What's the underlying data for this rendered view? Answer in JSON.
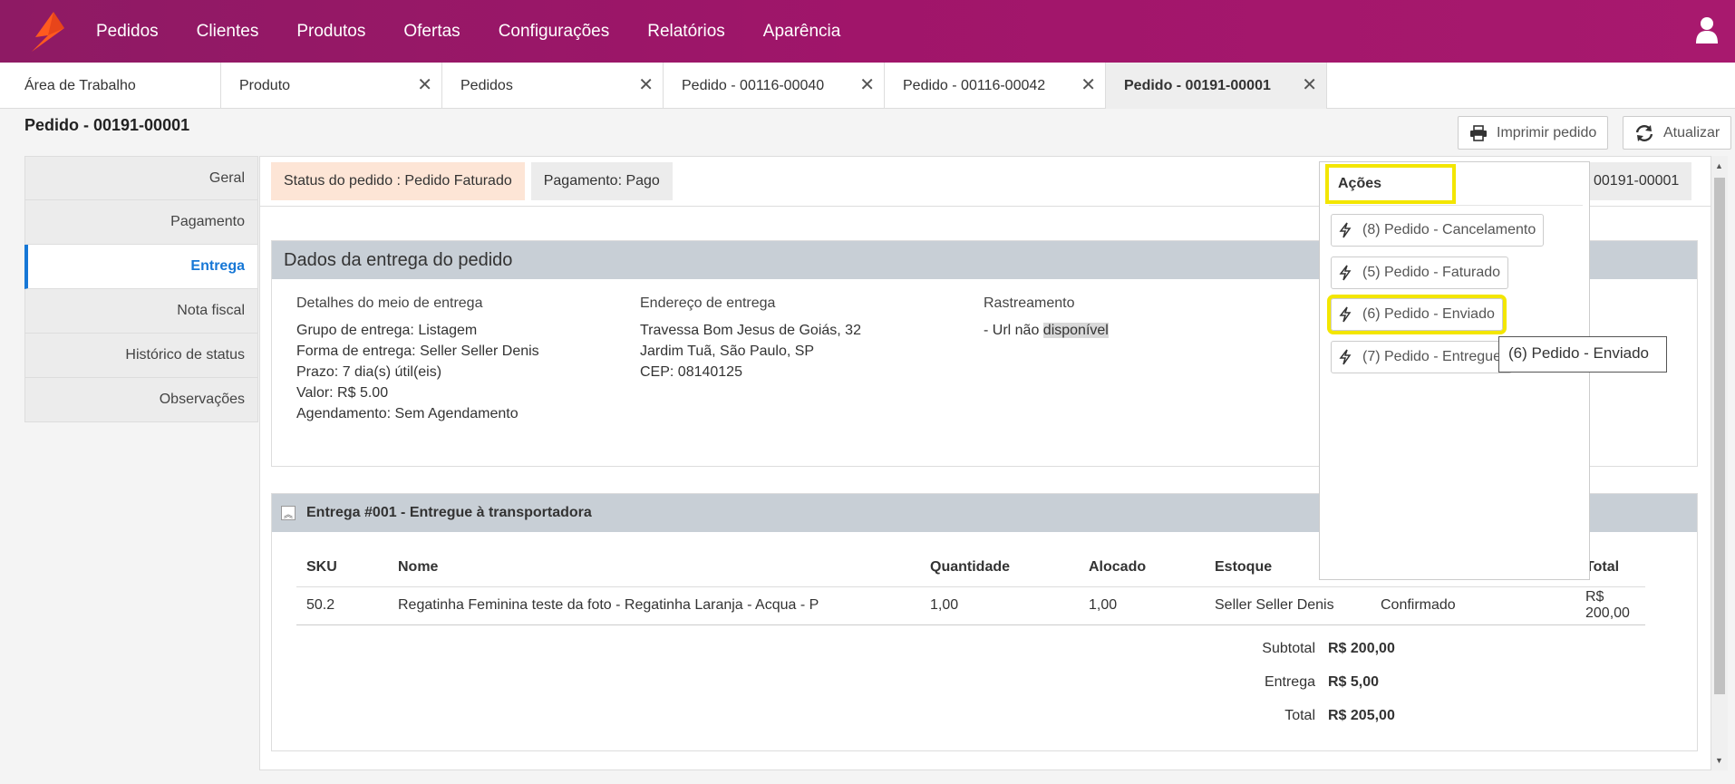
{
  "navbar": {
    "items": [
      "Pedidos",
      "Clientes",
      "Produtos",
      "Ofertas",
      "Configurações",
      "Relatórios",
      "Aparência"
    ]
  },
  "tabs": [
    {
      "label": "Área de Trabalho"
    },
    {
      "label": "Produto"
    },
    {
      "label": "Pedidos"
    },
    {
      "label": "Pedido - 00116-00040"
    },
    {
      "label": "Pedido - 00116-00042"
    },
    {
      "label": "Pedido - 00191-00001"
    }
  ],
  "page": {
    "title": "Pedido - 00191-00001",
    "print_label": "Imprimir pedido",
    "refresh_label": "Atualizar"
  },
  "sidemenu": [
    "Geral",
    "Pagamento",
    "Entrega",
    "Nota fiscal",
    "Histórico de status",
    "Observações"
  ],
  "status": {
    "order": "Status do pedido : Pedido Faturado",
    "payment": "Pagamento: Pago",
    "code": "00191-00001"
  },
  "delivery": {
    "title": "Dados da entrega do pedido",
    "method_header": "Detalhes do meio de entrega",
    "method_lines": [
      "Grupo de entrega: Listagem",
      "Forma de entrega: Seller Seller Denis",
      "Prazo: 7 dia(s) útil(eis)",
      "Valor: R$ 5.00",
      "Agendamento: Sem Agendamento"
    ],
    "address_header": "Endereço de entrega",
    "address_lines": [
      "Travessa Bom Jesus de Goiás, 32",
      "Jardim Tuã, São Paulo, SP",
      "CEP: 08140125"
    ],
    "tracking_header": "Rastreamento",
    "tracking_prefix": "- Url não ",
    "tracking_highlight": "disponível"
  },
  "shipment": {
    "title": "Entrega #001 - Entregue à transportadora",
    "columns": [
      "SKU",
      "Nome",
      "Quantidade",
      "Alocado",
      "Estoque",
      "",
      "Total"
    ],
    "rows": [
      [
        "50.2",
        "Regatinha Feminina teste da foto - Regatinha Laranja - Acqua - P",
        "1,00",
        "1,00",
        "Seller Seller Denis",
        "Confirmado",
        "R$ 200,00"
      ]
    ],
    "totals": [
      {
        "label": "Subtotal",
        "value": "R$ 200,00"
      },
      {
        "label": "Entrega",
        "value": "R$ 5,00"
      },
      {
        "label": "Total",
        "value": "R$ 205,00"
      }
    ]
  },
  "actions": {
    "title": "Ações",
    "items": [
      "(8) Pedido - Cancelamento",
      "(5) Pedido - Faturado",
      "(6) Pedido - Enviado",
      "(7) Pedido - Entregue"
    ],
    "tooltip": "(6) Pedido - Enviado"
  },
  "colors": {
    "brand": "#a0156a",
    "accent": "#1677d6",
    "highlight": "#f3e600"
  }
}
